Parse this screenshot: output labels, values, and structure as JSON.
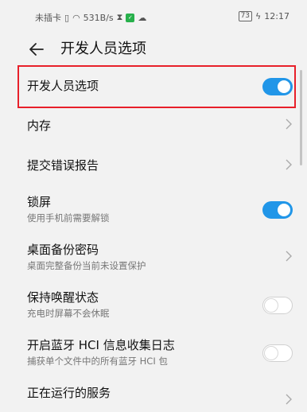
{
  "status_bar": {
    "left_text": "未插卡",
    "net_speed": "531B/s",
    "battery": "73",
    "time": "12:17"
  },
  "header": {
    "title": "开发人员选项"
  },
  "rows": [
    {
      "title": "开发人员选项",
      "subtitle": "",
      "control": "toggle",
      "on": true
    },
    {
      "title": "内存",
      "subtitle": "",
      "control": "chevron"
    },
    {
      "title": "提交错误报告",
      "subtitle": "",
      "control": "chevron"
    },
    {
      "title": "锁屏",
      "subtitle": "使用手机前需要解锁",
      "control": "toggle",
      "on": true
    },
    {
      "title": "桌面备份密码",
      "subtitle": "桌面完整备份当前未设置保护",
      "control": "chevron"
    },
    {
      "title": "保持唤醒状态",
      "subtitle": "充电时屏幕不会休眠",
      "control": "toggle",
      "on": false
    },
    {
      "title": "开启蓝牙 HCI 信息收集日志",
      "subtitle": "捕获单个文件中的所有蓝牙 HCI 包",
      "control": "toggle",
      "on": false
    },
    {
      "title": "正在运行的服务",
      "subtitle": "",
      "control": "chevron"
    }
  ],
  "colors": {
    "accent": "#2196e8",
    "highlight": "#e8202a"
  }
}
